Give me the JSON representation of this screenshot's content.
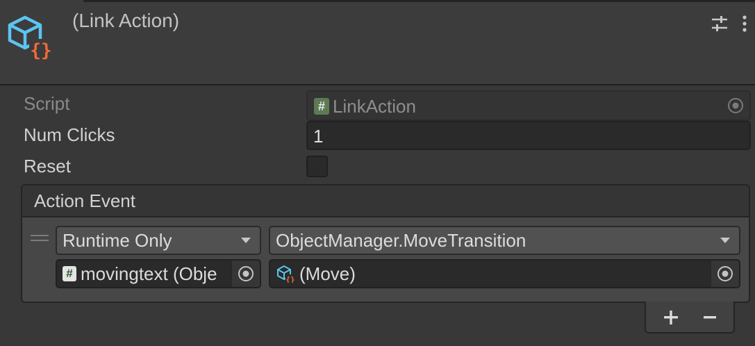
{
  "header": {
    "title": "(Link Action)",
    "component_icon": "script-cube-icon",
    "settings_icon": "sliders-icon",
    "menu_icon": "kebab-menu-icon"
  },
  "properties": {
    "script": {
      "label": "Script",
      "value": "LinkAction",
      "icon": "csharp-script-icon"
    },
    "num_clicks": {
      "label": "Num Clicks",
      "value": "1"
    },
    "reset": {
      "label": "Reset",
      "checked": false
    }
  },
  "action_event": {
    "title": "Action Event",
    "entries": [
      {
        "call_state": "Runtime Only",
        "function": "ObjectManager.MoveTransition",
        "target": "movingtext (Obje",
        "argument": "(Move)"
      }
    ],
    "add_label": "+",
    "remove_label": "−"
  },
  "colors": {
    "background": "#383838",
    "field": "#2a2a2a",
    "accent_cube": "#5cc4f2",
    "accent_braces": "#f26b3a"
  }
}
